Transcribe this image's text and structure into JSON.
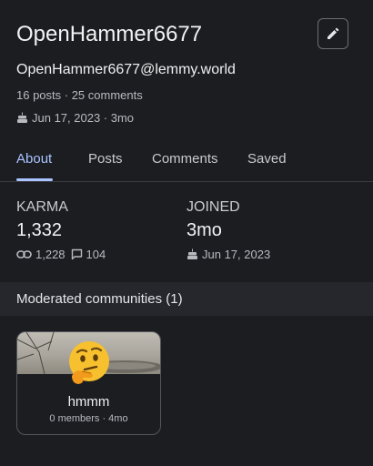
{
  "profile": {
    "username": "OpenHammer6677",
    "full_handle": "OpenHammer6677@lemmy.world",
    "counts": "16 posts · 25 comments",
    "cake_day": "Jun 17, 2023 · 3mo"
  },
  "tabs": [
    {
      "label": "About"
    },
    {
      "label": "Posts"
    },
    {
      "label": "Comments"
    },
    {
      "label": "Saved"
    }
  ],
  "stats": {
    "karma": {
      "label": "KARMA",
      "value": "1,332",
      "post_karma": "1,228",
      "comment_karma": "104"
    },
    "joined": {
      "label": "JOINED",
      "value": "3mo",
      "date": "Jun 17, 2023"
    }
  },
  "moderated": {
    "header": "Moderated communities (1)",
    "communities": [
      {
        "name": "hmmm",
        "meta": "0 members · 4mo",
        "icon": "thinking-face-icon"
      }
    ]
  },
  "colors": {
    "background": "#1c1d21",
    "accent": "#a9c4ff",
    "section_header_bg": "#26272c"
  }
}
